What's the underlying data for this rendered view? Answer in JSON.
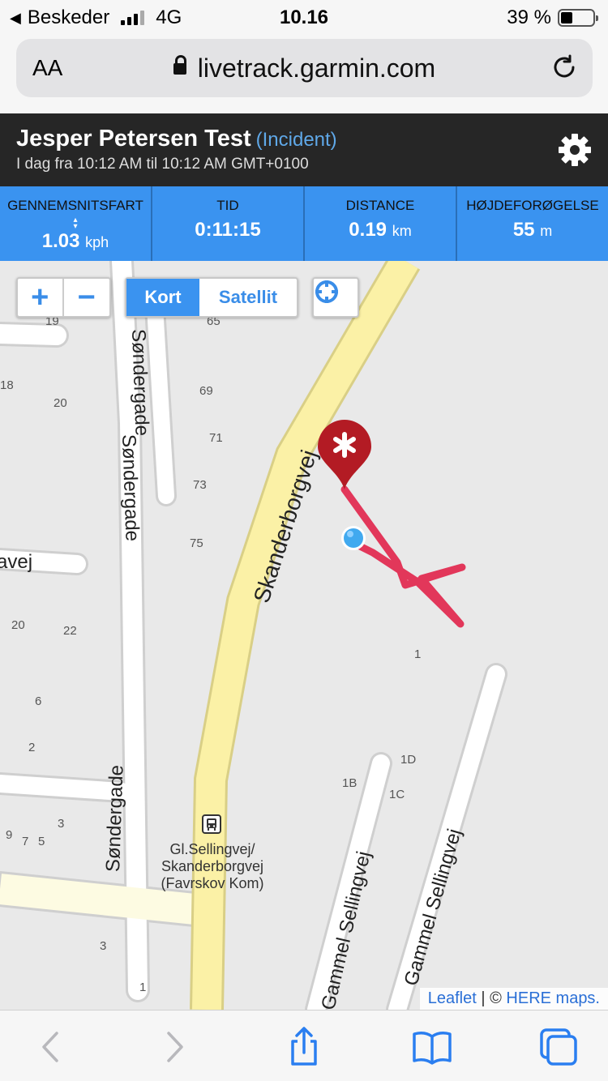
{
  "status_bar": {
    "back_label": "Beskeder",
    "network": "4G",
    "time": "10.16",
    "battery_text": "39 %"
  },
  "browser": {
    "text_size_label": "AA",
    "url": "livetrack.garmin.com"
  },
  "header": {
    "name": "Jesper Petersen Test",
    "status": "(Incident)",
    "date_range": "I dag fra 10:12 AM til 10:12 AM GMT+0100"
  },
  "stats": [
    {
      "label": "GENNEMSNITSFART",
      "value": "1.03",
      "unit": "kph"
    },
    {
      "label": "TID",
      "value": "0:11:15",
      "unit": ""
    },
    {
      "label": "DISTANCE",
      "value": "0.19",
      "unit": "km"
    },
    {
      "label": "HØJDEFORØGELSE",
      "value": "55",
      "unit": "m"
    }
  ],
  "map_controls": {
    "zoom_in": "+",
    "zoom_out": "−",
    "layer_map": "Kort",
    "layer_satellite": "Satellit"
  },
  "map": {
    "streets": {
      "skanderborgvej": "Skanderborgvej",
      "sondergade": "Søndergade",
      "gammel_sellingvej": "Gammel Sellingvej",
      "partial_street": "avej"
    },
    "bus_stop": {
      "line1": "Gl.Sellingvej/",
      "line2": "Skanderborgvej",
      "line3": "(Favrskov Kom)"
    },
    "house_numbers": {
      "n19": "19",
      "n65": "65",
      "n18": "18",
      "n20a": "20",
      "n69": "69",
      "n71": "71",
      "n73": "73",
      "n75": "75",
      "n20b": "20",
      "n22": "22",
      "n6": "6",
      "n2": "2",
      "n1": "1",
      "n1D": "1D",
      "n1B": "1B",
      "n1C": "1C",
      "n9": "9",
      "n7": "7",
      "n5": "5",
      "n3a": "3",
      "n3b": "3",
      "n1b": "1"
    },
    "attribution_leaflet": "Leaflet",
    "attribution_sep": "| ©",
    "attribution_here": "HERE maps."
  },
  "colors": {
    "header_bg": "#262626",
    "stats_bg": "#3a93f0",
    "track": "#e2375a",
    "pin": "#b31b24",
    "major_road": "#fbf1a6"
  },
  "icons": {
    "settings": "gear-icon",
    "locate": "crosshair-icon",
    "incident_pin": "map-pin-asterisk-icon",
    "current_location": "location-dot-icon",
    "bus_stop": "bus-icon"
  }
}
